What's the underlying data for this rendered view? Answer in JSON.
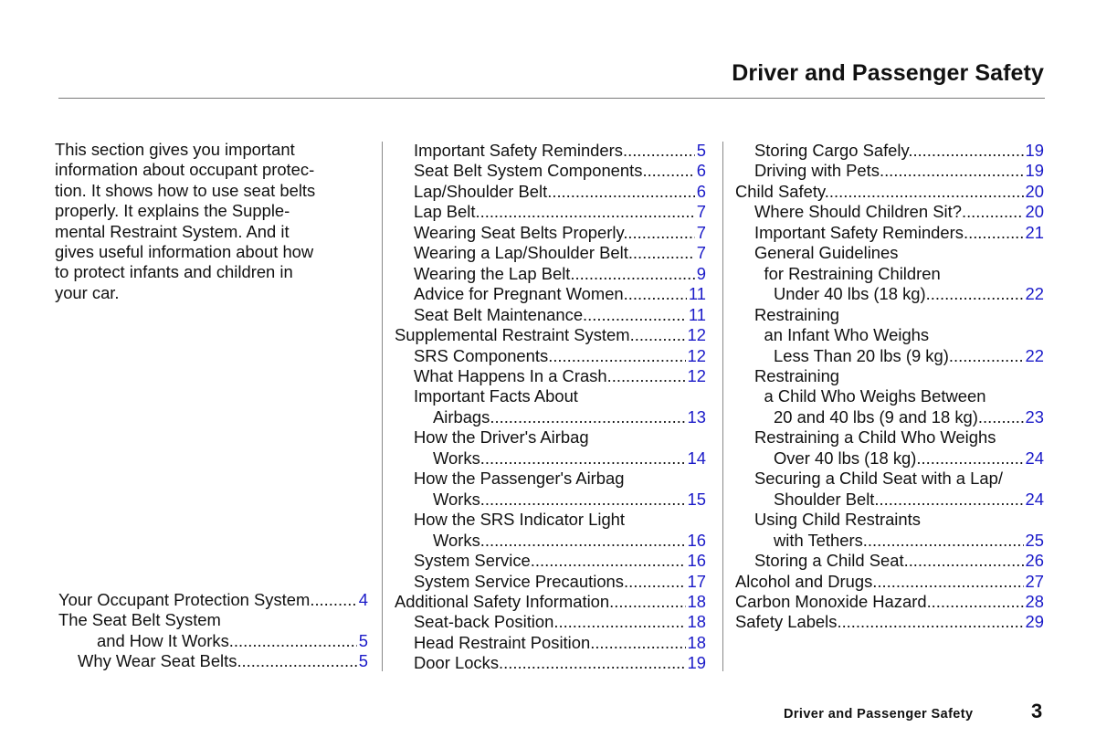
{
  "header": {
    "title": "Driver and Passenger Safety"
  },
  "intro": "This section gives you important\ninformation about occupant protec-\ntion. It shows how to use seat belts\nproperly. It explains the Supple-\nmental Restraint System. And it\ngives useful information about how\nto protect infants and children in\nyour car.",
  "toc": {
    "col1": [
      {
        "text": "Your Occupant Protection System",
        "page": "4",
        "indent": 0
      },
      {
        "text": "The Seat Belt System",
        "page": "",
        "indent": 0
      },
      {
        "text": "and How It Works",
        "page": "5",
        "indent": 2
      },
      {
        "text": "Why Wear Seat Belts",
        "page": "5",
        "indent": 1
      }
    ],
    "col2": [
      {
        "text": "Important Safety Reminders",
        "page": "5",
        "indent": 1
      },
      {
        "text": "Seat Belt System Components",
        "page": "6",
        "indent": 1
      },
      {
        "text": "Lap/Shoulder Belt",
        "page": "6",
        "indent": 1
      },
      {
        "text": "Lap Belt",
        "page": "7",
        "indent": 1
      },
      {
        "text": "Wearing Seat Belts Properly",
        "page": "7",
        "indent": 1
      },
      {
        "text": "Wearing a Lap/Shoulder Belt",
        "page": "7",
        "indent": 1
      },
      {
        "text": "Wearing the Lap Belt",
        "page": "9",
        "indent": 1
      },
      {
        "text": "Advice for Pregnant Women",
        "page": "11",
        "indent": 1
      },
      {
        "text": "Seat Belt Maintenance",
        "page": "11",
        "indent": 1
      },
      {
        "text": "Supplemental Restraint System",
        "page": "12",
        "indent": 0
      },
      {
        "text": "SRS Components",
        "page": "12",
        "indent": 1
      },
      {
        "text": "What Happens In a Crash",
        "page": "12",
        "indent": 1
      },
      {
        "text": "Important Facts About",
        "page": "",
        "indent": 1
      },
      {
        "text": "Airbags",
        "page": "13",
        "indent": 2
      },
      {
        "text": "How the Driver's Airbag",
        "page": "",
        "indent": 1
      },
      {
        "text": "Works",
        "page": "14",
        "indent": 2
      },
      {
        "text": "How the Passenger's Airbag",
        "page": "",
        "indent": 1
      },
      {
        "text": "Works",
        "page": "15",
        "indent": 2
      },
      {
        "text": "How the SRS Indicator Light",
        "page": "",
        "indent": 1
      },
      {
        "text": "Works",
        "page": "16",
        "indent": 2
      },
      {
        "text": "System Service",
        "page": "16",
        "indent": 1
      },
      {
        "text": "System Service Precautions",
        "page": "17",
        "indent": 1
      },
      {
        "text": "Additional Safety Information",
        "page": "18",
        "indent": 0
      },
      {
        "text": "Seat-back Position",
        "page": "18",
        "indent": 1
      },
      {
        "text": "Head Restraint Position",
        "page": "18",
        "indent": 1
      },
      {
        "text": "Door Locks",
        "page": "19",
        "indent": 1
      }
    ],
    "col3": [
      {
        "text": "Storing Cargo Safely",
        "page": "19",
        "indent": 1
      },
      {
        "text": "Driving with Pets",
        "page": "19",
        "indent": 1
      },
      {
        "text": "Child Safety",
        "page": "20",
        "indent": 0
      },
      {
        "text": "Where Should Children Sit?",
        "page": "20",
        "indent": 1
      },
      {
        "text": "Important Safety Reminders",
        "page": "21",
        "indent": 1
      },
      {
        "text": "General Guidelines",
        "page": "",
        "indent": 1
      },
      {
        "text": "for Restraining Children",
        "page": "",
        "indent": 1.5
      },
      {
        "text": "Under 40 lbs (18 kg)",
        "page": "22",
        "indent": 2
      },
      {
        "text": "Restraining",
        "page": "",
        "indent": 1
      },
      {
        "text": "an Infant Who Weighs",
        "page": "",
        "indent": 1.5
      },
      {
        "text": "Less Than 20 lbs (9 kg)",
        "page": "22",
        "indent": 2
      },
      {
        "text": "Restraining",
        "page": "",
        "indent": 1
      },
      {
        "text": "a Child Who Weighs Between",
        "page": "",
        "indent": 1.5
      },
      {
        "text": "20 and 40 lbs (9 and 18 kg)",
        "page": "23",
        "indent": 2
      },
      {
        "text": "Restraining a Child Who Weighs",
        "page": "",
        "indent": 1
      },
      {
        "text": "Over 40 lbs (18 kg)",
        "page": "24",
        "indent": 2
      },
      {
        "text": "Securing a Child Seat with a Lap/",
        "page": "",
        "indent": 1
      },
      {
        "text": "Shoulder Belt",
        "page": "24",
        "indent": 2
      },
      {
        "text": "Using Child Restraints",
        "page": "",
        "indent": 1
      },
      {
        "text": "with Tethers",
        "page": "25",
        "indent": 2
      },
      {
        "text": "Storing a Child Seat",
        "page": "26",
        "indent": 1
      },
      {
        "text": "Alcohol and Drugs",
        "page": "27",
        "indent": 0
      },
      {
        "text": "Carbon Monoxide Hazard",
        "page": "28",
        "indent": 0
      },
      {
        "text": "Safety Labels",
        "page": "29",
        "indent": 0
      }
    ]
  },
  "footer": {
    "section": "Driver and Passenger Safety",
    "page_number": "3"
  },
  "colors": {
    "page_link": "#1a1ac8",
    "text": "#111111",
    "rule": "#7a7a7a"
  }
}
